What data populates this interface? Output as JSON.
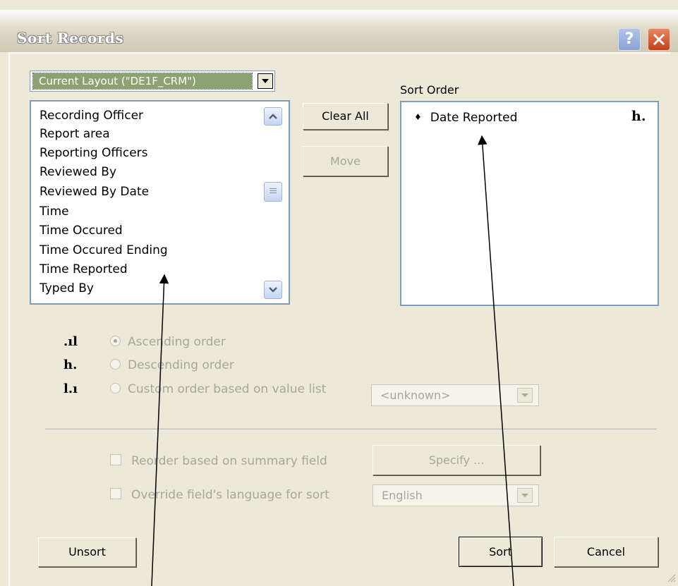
{
  "dialog": {
    "title": "Sort Records",
    "help_label": "?",
    "close_icon": "close-icon"
  },
  "layout_selector": {
    "value": "Current Layout (\"DE1F_CRM\")"
  },
  "field_list": {
    "items": [
      "Recording Officer",
      "Report area",
      "Reporting Officers",
      "Reviewed By",
      "Reviewed By Date",
      "Time",
      "Time Occured",
      "Time Occured Ending",
      "Time Reported",
      "Typed By"
    ]
  },
  "buttons": {
    "clear_all": "Clear All",
    "move": "Move",
    "specify": "Specify ...",
    "unsort": "Unsort",
    "sort": "Sort",
    "cancel": "Cancel"
  },
  "sort_order": {
    "label": "Sort Order",
    "items": [
      {
        "field": "Date Reported",
        "direction_icon": "descending-icon"
      }
    ]
  },
  "order_options": {
    "ascending": "Ascending order",
    "descending": "Descending order",
    "custom": "Custom order based on value list",
    "value_list": "<unknown>",
    "selected": "ascending"
  },
  "options": {
    "reorder": "Reorder based on summary field",
    "override_language": "Override field's language for sort",
    "language": "English"
  },
  "colors": {
    "dialog_bg": "#ece9d8",
    "selected_combo": "#8da273",
    "list_border": "#7f9db9",
    "disabled_text": "#a7a69a"
  }
}
